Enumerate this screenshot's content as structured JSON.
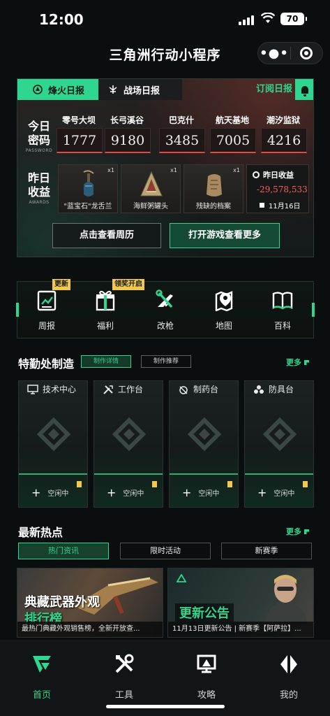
{
  "status_bar": {
    "time": "12:00",
    "battery": "70"
  },
  "nav": {
    "title": "三角洲行动小程序"
  },
  "hero": {
    "tab_fire": "烽火日报",
    "tab_battle": "战场日报",
    "subscribe": "订阅日报",
    "password_label": "今日\n密码",
    "password_label_top": "今日",
    "password_label_bottom": "密码",
    "password_en": "PASSWORD",
    "passwords": [
      {
        "map": "零号大坝",
        "code": "1777"
      },
      {
        "map": "长弓溪谷",
        "code": "9180"
      },
      {
        "map": "巴克什",
        "code": "3485"
      },
      {
        "map": "航天基地",
        "code": "7005"
      },
      {
        "map": "潮汐监狱",
        "code": "4216"
      }
    ],
    "awards_label_top": "昨日",
    "awards_label_bottom": "收益",
    "awards_en": "AWARDS",
    "awards": [
      {
        "name": "\"蓝宝石\"龙舌兰",
        "count": "x1"
      },
      {
        "name": "海鲜粥罐头",
        "count": "x1"
      },
      {
        "name": "残缺的档案",
        "count": "x1"
      }
    ],
    "income_title": "昨日收益",
    "income_value": "-29,578,533",
    "income_date": "11月16日",
    "btn_week": "点击查看周历",
    "btn_game": "打开游戏查看更多",
    "accent": "#2fd68f"
  },
  "quick": [
    {
      "label": "周报",
      "icon": "report-icon",
      "tag": "更新"
    },
    {
      "label": "福利",
      "icon": "gift-icon",
      "tag": "领奖开启"
    },
    {
      "label": "改枪",
      "icon": "gun-wrench-icon",
      "tag": ""
    },
    {
      "label": "地图",
      "icon": "map-pin-icon",
      "tag": ""
    },
    {
      "label": "百科",
      "icon": "book-icon",
      "tag": ""
    }
  ],
  "special": {
    "title": "特勤处制造",
    "pill_detail": "制作详情",
    "pill_recommend": "制作推荐",
    "more": "更多",
    "benches": [
      {
        "name": "技术中心",
        "icon": "monitor-icon",
        "status": "空闲中"
      },
      {
        "name": "工作台",
        "icon": "tools-icon",
        "status": "空闲中"
      },
      {
        "name": "制药台",
        "icon": "pharma-icon",
        "status": "空闲中"
      },
      {
        "name": "防具台",
        "icon": "armor-icon",
        "status": "空闲中"
      }
    ]
  },
  "news": {
    "title": "最新热点",
    "more": "更多",
    "tabs": [
      "热门资讯",
      "限时活动",
      "新赛季"
    ],
    "card_a": {
      "big1": "典藏武器外观",
      "big2": "排行榜",
      "caption": "最热门典藏外观销售榜，全新开放查..."
    },
    "card_b": {
      "big": "更新公告",
      "caption": "11月13日更新公告 | 新赛季【阿萨拉】..."
    }
  },
  "tabbar": [
    {
      "label": "首页",
      "icon": "home-logo-icon",
      "active": true
    },
    {
      "label": "工具",
      "icon": "tools-icon",
      "active": false
    },
    {
      "label": "攻略",
      "icon": "guide-icon",
      "active": false
    },
    {
      "label": "我的",
      "icon": "profile-icon",
      "active": false
    }
  ]
}
